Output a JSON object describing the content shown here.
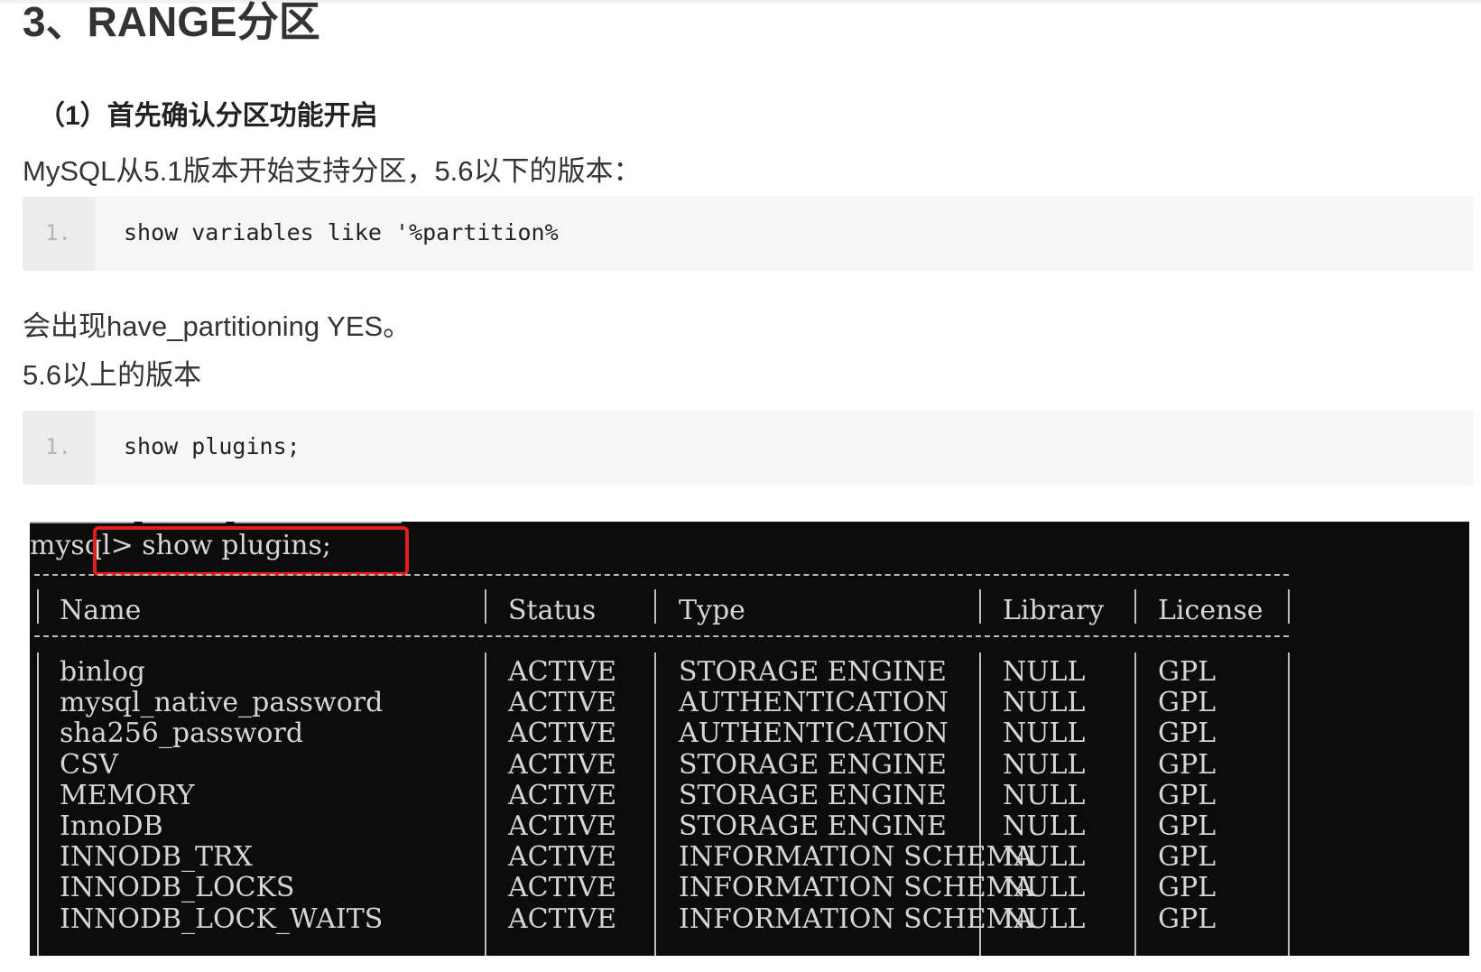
{
  "heading": "3、RANGE分区",
  "subheading": "（1）首先确认分区功能开启",
  "paragraph1": "MySQL从5.1版本开始支持分区，5.6以下的版本：",
  "code1": {
    "line_no": "1.",
    "code": "show variables like '%partition%"
  },
  "paragraph2": "会出现have_partitioning YES。",
  "paragraph3": "5.6以上的版本",
  "code2": {
    "line_no": "1.",
    "code": "show plugins;"
  },
  "terminal": {
    "prompt": "mysql> show plugins;",
    "columns": [
      "Name",
      "Status",
      "Type",
      "Library",
      "License"
    ],
    "rows": [
      [
        "binlog",
        "ACTIVE",
        "STORAGE ENGINE",
        "NULL",
        "GPL"
      ],
      [
        "mysql_native_password",
        "ACTIVE",
        "AUTHENTICATION",
        "NULL",
        "GPL"
      ],
      [
        "sha256_password",
        "ACTIVE",
        "AUTHENTICATION",
        "NULL",
        "GPL"
      ],
      [
        "CSV",
        "ACTIVE",
        "STORAGE ENGINE",
        "NULL",
        "GPL"
      ],
      [
        "MEMORY",
        "ACTIVE",
        "STORAGE ENGINE",
        "NULL",
        "GPL"
      ],
      [
        "InnoDB",
        "ACTIVE",
        "STORAGE ENGINE",
        "NULL",
        "GPL"
      ],
      [
        "INNODB_TRX",
        "ACTIVE",
        "INFORMATION SCHEMA",
        "NULL",
        "GPL"
      ],
      [
        "INNODB_LOCKS",
        "ACTIVE",
        "INFORMATION SCHEMA",
        "NULL",
        "GPL"
      ],
      [
        "INNODB_LOCK_WAITS",
        "ACTIVE",
        "INFORMATION SCHEMA",
        "NULL",
        "GPL"
      ]
    ],
    "highlight_color": "#e01e1e"
  }
}
